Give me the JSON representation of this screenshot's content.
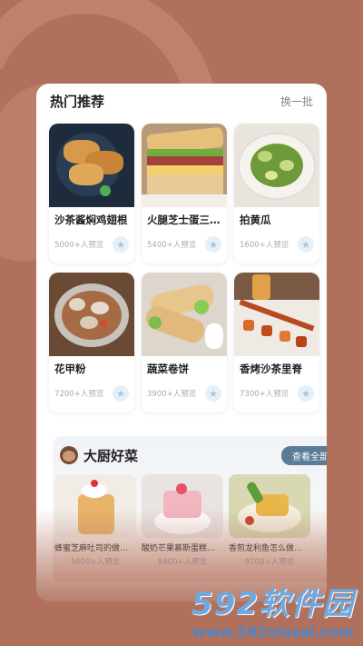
{
  "hot": {
    "title": "热门推荐",
    "refresh_label": "换一批",
    "items": [
      {
        "name": "沙茶酱焖鸡翅根",
        "views": "5000+人预览",
        "icon": "star-icon"
      },
      {
        "name": "火腿芝士蛋三…",
        "views": "5400+人预览",
        "icon": "star-icon"
      },
      {
        "name": "拍黄瓜",
        "views": "1600+人预览",
        "icon": "star-icon"
      },
      {
        "name": "花甲粉",
        "views": "7200+人预览",
        "icon": "star-icon"
      },
      {
        "name": "蔬菜卷饼",
        "views": "3900+人预览",
        "icon": "star-icon"
      },
      {
        "name": "香烤沙茶里脊",
        "views": "7300+人预览",
        "icon": "star-icon"
      }
    ]
  },
  "chef": {
    "title": "大厨好菜",
    "see_all_label": "查看全部",
    "items": [
      {
        "name": "蜂蜜芝麻吐司的做…",
        "views": "5600+人预览"
      },
      {
        "name": "酸奶芒果慕斯蛋糕…",
        "views": "8400+人预览"
      },
      {
        "name": "香煎龙利鱼怎么做…",
        "views": "9700+人预览"
      }
    ]
  },
  "watermark": {
    "brand": "592软件园",
    "url": "www.592xiazai.com"
  },
  "colors": {
    "background": "#b0705c",
    "accent_button": "#5a7c96",
    "fav_bg": "#e6f0f8"
  }
}
